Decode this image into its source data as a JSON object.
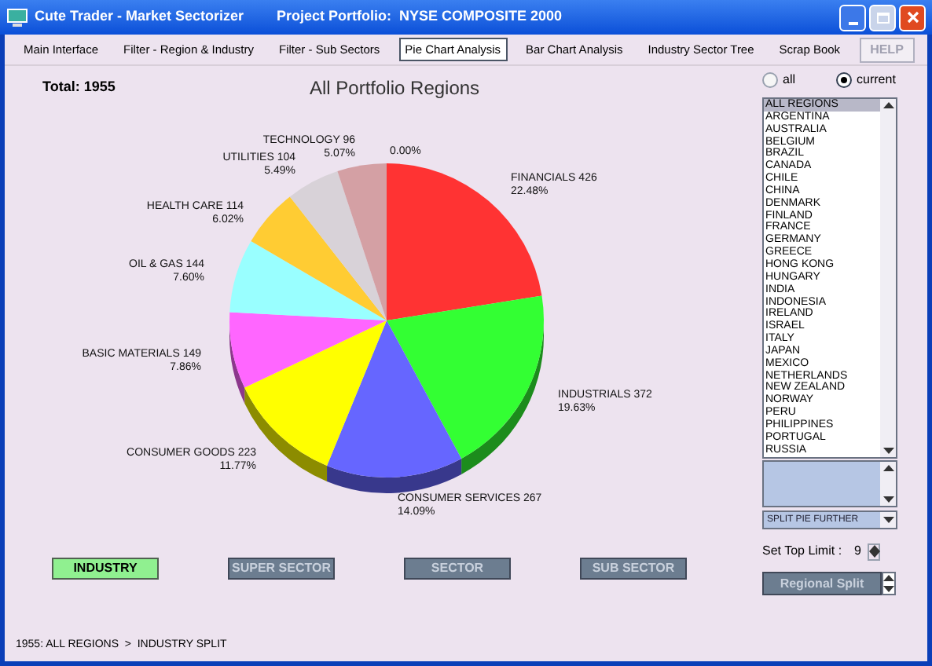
{
  "window": {
    "title": "Cute Trader - Market Sectorizer",
    "project": "Project Portfolio:  NYSE COMPOSITE 2000"
  },
  "tabs": [
    {
      "label": "Main Interface",
      "selected": false
    },
    {
      "label": "Filter - Region & Industry",
      "selected": false
    },
    {
      "label": "Filter - Sub Sectors",
      "selected": false
    },
    {
      "label": "Pie Chart Analysis",
      "selected": true
    },
    {
      "label": "Bar Chart Analysis",
      "selected": false
    },
    {
      "label": "Industry Sector Tree",
      "selected": false
    },
    {
      "label": "Scrap Book",
      "selected": false
    }
  ],
  "help_button": "HELP",
  "chart": {
    "total": "Total: 1955",
    "zero_label": "0.00%",
    "percents": [
      "22.48%",
      "19.63%",
      "14.09%",
      "11.77%",
      "7.86%",
      "7.60%",
      "6.02%",
      "5.49%",
      "5.07%"
    ],
    "chart_data": {
      "type": "pie",
      "title": "All Portfolio Regions",
      "categories": [
        "FINANCIALS 426",
        "INDUSTRIALS 372",
        "CONSUMER SERVICES 267",
        "CONSUMER GOODS 223",
        "BASIC MATERIALS 149",
        "OIL & GAS 144",
        "HEALTH CARE 114",
        "UTILITIES 104",
        "TECHNOLOGY 96"
      ],
      "values": [
        426,
        372,
        267,
        223,
        149,
        144,
        114,
        104,
        96
      ],
      "colors": [
        "#ff3333",
        "#33ff33",
        "#6666ff",
        "#ffff00",
        "#ff66ff",
        "#99ffff",
        "#ffcc33",
        "#d8d2d8",
        "#d4a0a4"
      ]
    }
  },
  "scope": [
    {
      "label": "all",
      "selected": false
    },
    {
      "label": "current",
      "selected": true
    }
  ],
  "regions": [
    {
      "label": "ALL REGIONS",
      "selected": true
    },
    {
      "label": "ARGENTINA",
      "selected": false
    },
    {
      "label": "AUSTRALIA",
      "selected": false
    },
    {
      "label": "BELGIUM",
      "selected": false
    },
    {
      "label": "BRAZIL",
      "selected": false
    },
    {
      "label": "CANADA",
      "selected": false
    },
    {
      "label": "CHILE",
      "selected": false
    },
    {
      "label": "CHINA",
      "selected": false
    },
    {
      "label": "DENMARK",
      "selected": false
    },
    {
      "label": "FINLAND",
      "selected": false
    },
    {
      "label": "FRANCE",
      "selected": false
    },
    {
      "label": "GERMANY",
      "selected": false
    },
    {
      "label": "GREECE",
      "selected": false
    },
    {
      "label": "HONG KONG",
      "selected": false
    },
    {
      "label": "HUNGARY",
      "selected": false
    },
    {
      "label": "INDIA",
      "selected": false
    },
    {
      "label": "INDONESIA",
      "selected": false
    },
    {
      "label": "IRELAND",
      "selected": false
    },
    {
      "label": "ISRAEL",
      "selected": false
    },
    {
      "label": "ITALY",
      "selected": false
    },
    {
      "label": "JAPAN",
      "selected": false
    },
    {
      "label": "MEXICO",
      "selected": false
    },
    {
      "label": "NETHERLANDS",
      "selected": false
    },
    {
      "label": "NEW ZEALAND",
      "selected": false
    },
    {
      "label": "NORWAY",
      "selected": false
    },
    {
      "label": "PERU",
      "selected": false
    },
    {
      "label": "PHILIPPINES",
      "selected": false
    },
    {
      "label": "PORTUGAL",
      "selected": false
    },
    {
      "label": "RUSSIA",
      "selected": false
    }
  ],
  "split_select": {
    "value": "SPLIT PIE FURTHER"
  },
  "top_limit": {
    "label": "Set Top Limit :",
    "value": "9"
  },
  "levels": [
    {
      "label": "INDUSTRY",
      "selected": true
    },
    {
      "label": "SUPER SECTOR",
      "selected": false
    },
    {
      "label": "SECTOR",
      "selected": false
    },
    {
      "label": "SUB SECTOR",
      "selected": false
    }
  ],
  "regional_split": {
    "label": "Regional Split"
  },
  "status_bar": "1955: ALL REGIONS  >  INDUSTRY SPLIT"
}
